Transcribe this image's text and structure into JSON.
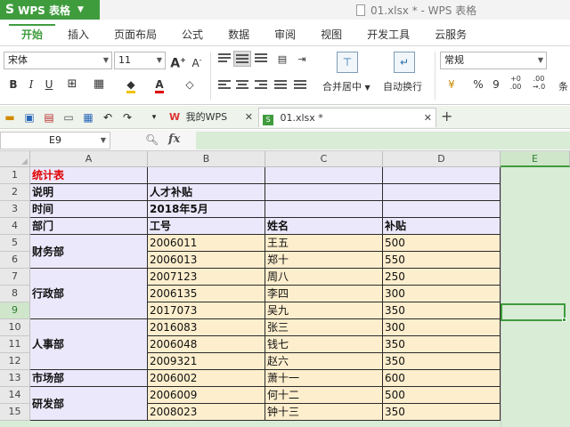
{
  "titlebar": {
    "app_button": "WPS 表格",
    "doc_title": "01.xlsx * - WPS 表格"
  },
  "ribbon_tabs": [
    "开始",
    "插入",
    "页面布局",
    "公式",
    "数据",
    "审阅",
    "视图",
    "开发工具",
    "云服务"
  ],
  "ribbon": {
    "font_name": "宋体",
    "font_size": "11",
    "merge_center": "合并居中",
    "wrap_text": "自动换行",
    "number_format": "常规",
    "percent": "%",
    "comma": "9",
    "cond_label": "条"
  },
  "doc_tabs": {
    "home": "我的WPS",
    "file": "01.xlsx *"
  },
  "formula_bar": {
    "name_box": "E9",
    "fx": "fx",
    "content": ""
  },
  "columns": [
    "A",
    "B",
    "C",
    "D",
    "E"
  ],
  "rows": [
    "1",
    "2",
    "3",
    "4",
    "5",
    "6",
    "7",
    "8",
    "9",
    "10",
    "11",
    "12",
    "13",
    "14",
    "15"
  ],
  "sheet": {
    "r1_title": "统计表",
    "r2_label": "说明",
    "r2_value": "人才补贴",
    "r3_label": "时间",
    "r3_value": "2018年5月",
    "headers": [
      "部门",
      "工号",
      "姓名",
      "补贴"
    ],
    "departments": [
      "财务部",
      "行政部",
      "人事部",
      "市场部",
      "研发部"
    ],
    "records": [
      {
        "id": "2006011",
        "name": "王五",
        "amount": "500"
      },
      {
        "id": "2006013",
        "name": "郑十",
        "amount": "550"
      },
      {
        "id": "2007123",
        "name": "周八",
        "amount": "250"
      },
      {
        "id": "2006135",
        "name": "李四",
        "amount": "300"
      },
      {
        "id": "2017073",
        "name": "吴九",
        "amount": "350"
      },
      {
        "id": "2016083",
        "name": "张三",
        "amount": "300"
      },
      {
        "id": "2006048",
        "name": "钱七",
        "amount": "350"
      },
      {
        "id": "2009321",
        "name": "赵六",
        "amount": "350"
      },
      {
        "id": "2006002",
        "name": "萧十一",
        "amount": "600"
      },
      {
        "id": "2006009",
        "name": "何十二",
        "amount": "500"
      },
      {
        "id": "2008023",
        "name": "钟十三",
        "amount": "350"
      }
    ]
  },
  "colors": {
    "brand_green": "#3f9c3d",
    "lavender_fill": "#ece8fb",
    "yellow_fill": "#fdeecd",
    "title_red": "#e00000"
  }
}
